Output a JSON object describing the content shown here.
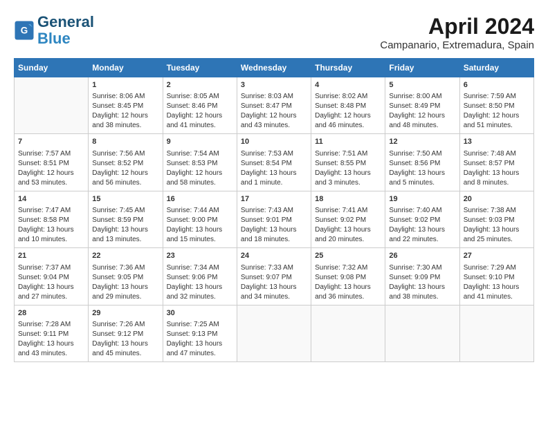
{
  "header": {
    "logo_line1": "General",
    "logo_line2": "Blue",
    "month": "April 2024",
    "location": "Campanario, Extremadura, Spain"
  },
  "weekdays": [
    "Sunday",
    "Monday",
    "Tuesday",
    "Wednesday",
    "Thursday",
    "Friday",
    "Saturday"
  ],
  "weeks": [
    [
      {
        "day": "",
        "data": ""
      },
      {
        "day": "1",
        "data": "Sunrise: 8:06 AM\nSunset: 8:45 PM\nDaylight: 12 hours\nand 38 minutes."
      },
      {
        "day": "2",
        "data": "Sunrise: 8:05 AM\nSunset: 8:46 PM\nDaylight: 12 hours\nand 41 minutes."
      },
      {
        "day": "3",
        "data": "Sunrise: 8:03 AM\nSunset: 8:47 PM\nDaylight: 12 hours\nand 43 minutes."
      },
      {
        "day": "4",
        "data": "Sunrise: 8:02 AM\nSunset: 8:48 PM\nDaylight: 12 hours\nand 46 minutes."
      },
      {
        "day": "5",
        "data": "Sunrise: 8:00 AM\nSunset: 8:49 PM\nDaylight: 12 hours\nand 48 minutes."
      },
      {
        "day": "6",
        "data": "Sunrise: 7:59 AM\nSunset: 8:50 PM\nDaylight: 12 hours\nand 51 minutes."
      }
    ],
    [
      {
        "day": "7",
        "data": "Sunrise: 7:57 AM\nSunset: 8:51 PM\nDaylight: 12 hours\nand 53 minutes."
      },
      {
        "day": "8",
        "data": "Sunrise: 7:56 AM\nSunset: 8:52 PM\nDaylight: 12 hours\nand 56 minutes."
      },
      {
        "day": "9",
        "data": "Sunrise: 7:54 AM\nSunset: 8:53 PM\nDaylight: 12 hours\nand 58 minutes."
      },
      {
        "day": "10",
        "data": "Sunrise: 7:53 AM\nSunset: 8:54 PM\nDaylight: 13 hours\nand 1 minute."
      },
      {
        "day": "11",
        "data": "Sunrise: 7:51 AM\nSunset: 8:55 PM\nDaylight: 13 hours\nand 3 minutes."
      },
      {
        "day": "12",
        "data": "Sunrise: 7:50 AM\nSunset: 8:56 PM\nDaylight: 13 hours\nand 5 minutes."
      },
      {
        "day": "13",
        "data": "Sunrise: 7:48 AM\nSunset: 8:57 PM\nDaylight: 13 hours\nand 8 minutes."
      }
    ],
    [
      {
        "day": "14",
        "data": "Sunrise: 7:47 AM\nSunset: 8:58 PM\nDaylight: 13 hours\nand 10 minutes."
      },
      {
        "day": "15",
        "data": "Sunrise: 7:45 AM\nSunset: 8:59 PM\nDaylight: 13 hours\nand 13 minutes."
      },
      {
        "day": "16",
        "data": "Sunrise: 7:44 AM\nSunset: 9:00 PM\nDaylight: 13 hours\nand 15 minutes."
      },
      {
        "day": "17",
        "data": "Sunrise: 7:43 AM\nSunset: 9:01 PM\nDaylight: 13 hours\nand 18 minutes."
      },
      {
        "day": "18",
        "data": "Sunrise: 7:41 AM\nSunset: 9:02 PM\nDaylight: 13 hours\nand 20 minutes."
      },
      {
        "day": "19",
        "data": "Sunrise: 7:40 AM\nSunset: 9:02 PM\nDaylight: 13 hours\nand 22 minutes."
      },
      {
        "day": "20",
        "data": "Sunrise: 7:38 AM\nSunset: 9:03 PM\nDaylight: 13 hours\nand 25 minutes."
      }
    ],
    [
      {
        "day": "21",
        "data": "Sunrise: 7:37 AM\nSunset: 9:04 PM\nDaylight: 13 hours\nand 27 minutes."
      },
      {
        "day": "22",
        "data": "Sunrise: 7:36 AM\nSunset: 9:05 PM\nDaylight: 13 hours\nand 29 minutes."
      },
      {
        "day": "23",
        "data": "Sunrise: 7:34 AM\nSunset: 9:06 PM\nDaylight: 13 hours\nand 32 minutes."
      },
      {
        "day": "24",
        "data": "Sunrise: 7:33 AM\nSunset: 9:07 PM\nDaylight: 13 hours\nand 34 minutes."
      },
      {
        "day": "25",
        "data": "Sunrise: 7:32 AM\nSunset: 9:08 PM\nDaylight: 13 hours\nand 36 minutes."
      },
      {
        "day": "26",
        "data": "Sunrise: 7:30 AM\nSunset: 9:09 PM\nDaylight: 13 hours\nand 38 minutes."
      },
      {
        "day": "27",
        "data": "Sunrise: 7:29 AM\nSunset: 9:10 PM\nDaylight: 13 hours\nand 41 minutes."
      }
    ],
    [
      {
        "day": "28",
        "data": "Sunrise: 7:28 AM\nSunset: 9:11 PM\nDaylight: 13 hours\nand 43 minutes."
      },
      {
        "day": "29",
        "data": "Sunrise: 7:26 AM\nSunset: 9:12 PM\nDaylight: 13 hours\nand 45 minutes."
      },
      {
        "day": "30",
        "data": "Sunrise: 7:25 AM\nSunset: 9:13 PM\nDaylight: 13 hours\nand 47 minutes."
      },
      {
        "day": "",
        "data": ""
      },
      {
        "day": "",
        "data": ""
      },
      {
        "day": "",
        "data": ""
      },
      {
        "day": "",
        "data": ""
      }
    ]
  ]
}
